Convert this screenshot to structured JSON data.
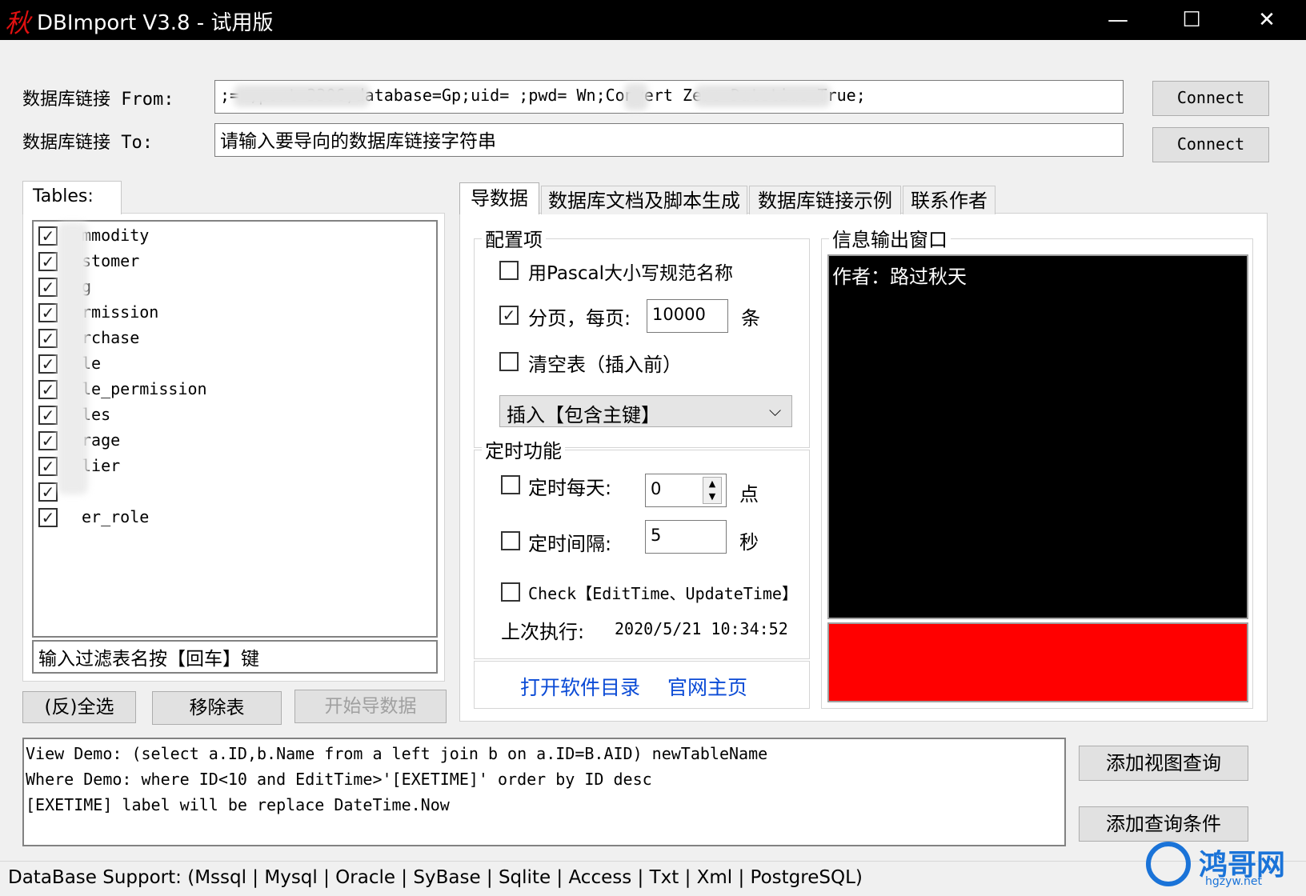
{
  "window": {
    "logo_glyph": "秋",
    "title": "DBImport V3.8 - 试用版",
    "minimize": "—",
    "maximize": "☐",
    "close": "✕"
  },
  "connection": {
    "from_label": "数据库链接 From:",
    "from_value": ";=                ;port=3306;database=Gp;uid=     ;pwd=                   Wn;Convert Zero Datetime=True;",
    "to_label": "数据库链接 To:",
    "to_placeholder": "请输入要导向的数据库链接字符串",
    "connect_label": "Connect"
  },
  "tables": {
    "header": "Tables:",
    "items": [
      {
        "name": "mmodity",
        "checked": true
      },
      {
        "name": "stomer",
        "checked": true
      },
      {
        "name": "g",
        "checked": true
      },
      {
        "name": "rmission",
        "checked": true
      },
      {
        "name": "rchase",
        "checked": true
      },
      {
        "name": "le",
        "checked": true
      },
      {
        "name": "le_permission",
        "checked": true
      },
      {
        "name": "les",
        "checked": true
      },
      {
        "name": "rage",
        "checked": true
      },
      {
        "name": "lier",
        "checked": true
      },
      {
        "name": "",
        "checked": true
      },
      {
        "name": "er_role",
        "checked": true
      }
    ],
    "filter_placeholder": "输入过滤表名按【回车】键"
  },
  "buttons": {
    "select_all": "(反)全选",
    "remove_table": "移除表",
    "start_import": "开始导数据",
    "add_view_query": "添加视图查询",
    "add_query_condition": "添加查询条件"
  },
  "tabs": [
    "导数据",
    "数据库文档及脚本生成",
    "数据库链接示例",
    "联系作者"
  ],
  "config": {
    "group_title": "配置项",
    "pascal_label": "用Pascal大小写规范名称",
    "pascal_checked": false,
    "paging_label": "分页，每页:",
    "paging_checked": true,
    "paging_value": "10000",
    "paging_unit": "条",
    "truncate_label": "清空表（插入前）",
    "truncate_checked": false,
    "insert_mode": "插入【包含主键】"
  },
  "timer": {
    "group_title": "定时功能",
    "daily_label": "定时每天:",
    "daily_checked": false,
    "daily_value": "0",
    "daily_unit": "点",
    "interval_label": "定时间隔:",
    "interval_checked": false,
    "interval_value": "5",
    "interval_unit": "秒",
    "check_label": "Check【EditTime、UpdateTime】",
    "check_checked": false,
    "last_run_label": "上次执行:",
    "last_run_value": "2020/5/21 10:34:52"
  },
  "links": {
    "open_dir": "打开软件目录",
    "homepage": "官网主页"
  },
  "output": {
    "group_title": "信息输出窗口",
    "text": "作者：路过秋天",
    "status_color": "#ff0000"
  },
  "query_box": {
    "lines": [
      "View  Demo: (select a.ID,b.Name from a left join b on a.ID=B.AID) newTableName",
      "Where Demo: where ID<10 and EditTime>'[EXETIME]' order by ID desc",
      "[EXETIME] label will be replace DateTime.Now"
    ]
  },
  "status_bar": {
    "text": "DataBase Support:    (Mssql | Mysql | Oracle | SyBase | Sqlite | Access | Txt | Xml | PostgreSQL)"
  },
  "watermark": {
    "text": "鸿哥网",
    "url": "hgzyw.net"
  }
}
